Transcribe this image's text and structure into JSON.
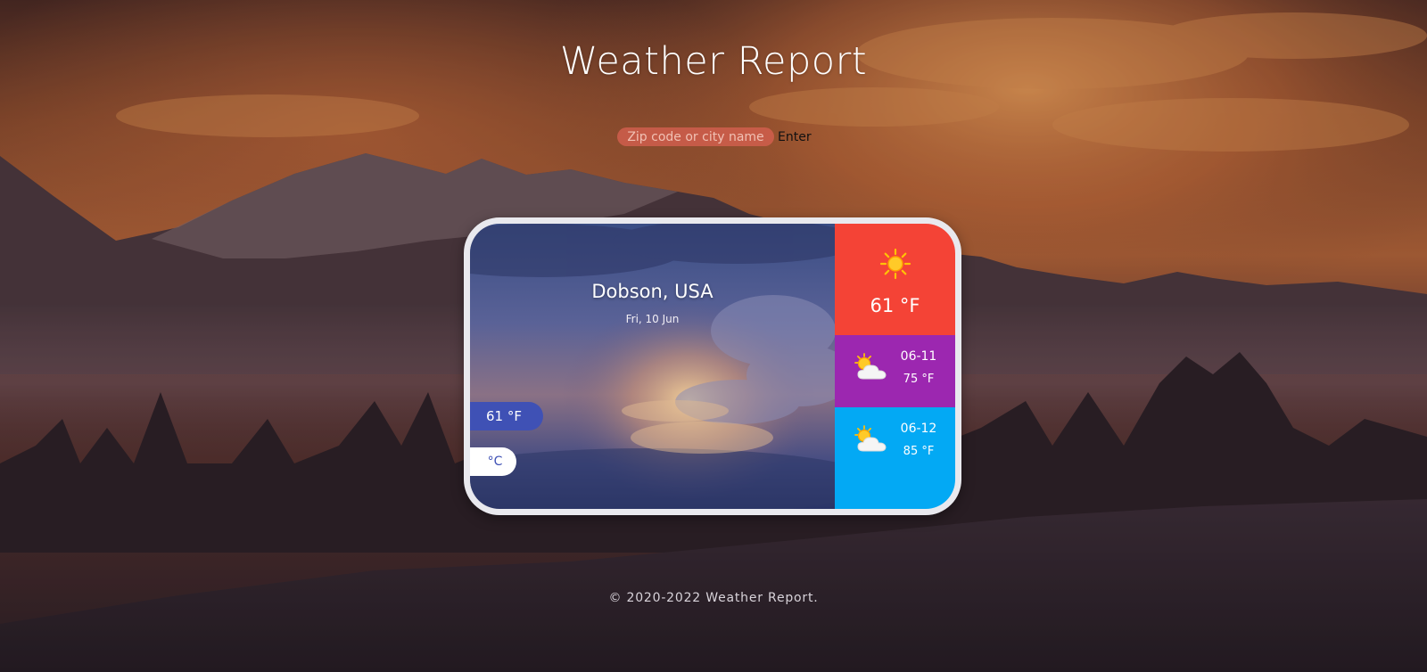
{
  "header": {
    "title": "Weather Report"
  },
  "search": {
    "placeholder": "Zip code or city name",
    "value": "",
    "button_label": "Enter"
  },
  "current": {
    "location": "Dobson, USA",
    "date": "Fri, 10 Jun",
    "temperature": "61 °F",
    "unit_toggle_label": "°C",
    "icon": "sun-icon"
  },
  "today": {
    "icon": "sun-icon",
    "temperature": "61 °F"
  },
  "forecast": [
    {
      "date": "06-11",
      "temperature": "75 °F",
      "icon": "partly-cloudy-icon"
    },
    {
      "date": "06-12",
      "temperature": "85 °F",
      "icon": "partly-cloudy-icon"
    }
  ],
  "footer": {
    "copyright": "© 2020-2022 Weather Report."
  },
  "colors": {
    "today_tile": "#f44336",
    "forecast_tile_1": "#9c27b0",
    "forecast_tile_2": "#03a9f4",
    "temp_pill": "#3f51b5",
    "card_border": "#e9e9ee"
  }
}
